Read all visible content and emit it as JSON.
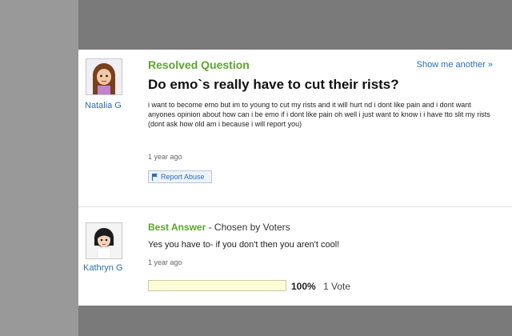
{
  "question": {
    "status": "Resolved Question",
    "show_another": "Show me another »",
    "asker": "Natalia G",
    "title": "Do emo`s really have to cut their rists?",
    "body": "i want to become emo but im to young to cut my rists and it will hurt nd i dont like pain and i dont want anyones opinion about how can i be emo if i dont like pain oh well i just want to know i i have tto slit my rists (dont ask how old am i because i will report you)",
    "time": "1 year ago",
    "report_label": "Report Abuse"
  },
  "answer": {
    "label": "Best Answer",
    "chosen_by": " - Chosen by Voters",
    "answerer": "Kathryn G",
    "text": "Yes you have to- if you don't then you aren't cool!",
    "time": "1 year ago",
    "vote_percent": "100%",
    "vote_fraction": 1.0,
    "vote_count": "1 Vote"
  },
  "colors": {
    "accent_green": "#5aa629",
    "link_blue": "#2a6fb3"
  }
}
